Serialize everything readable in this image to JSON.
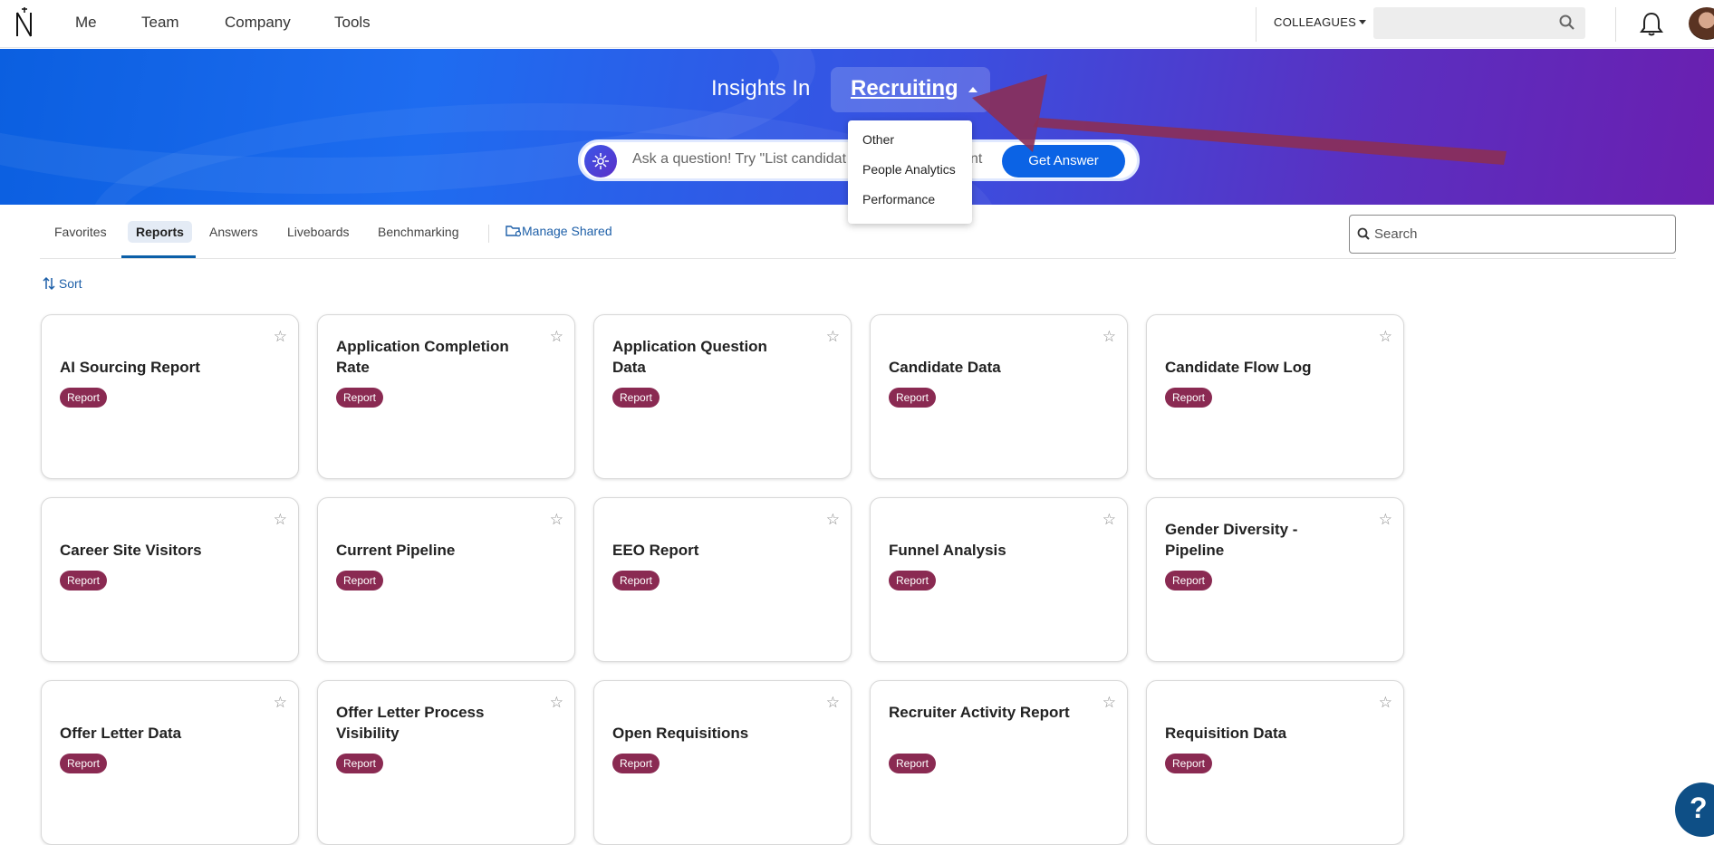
{
  "nav": {
    "links": [
      "Me",
      "Team",
      "Company",
      "Tools"
    ],
    "colleagues_label": "COLLEAGUES",
    "search_placeholder": ""
  },
  "hero": {
    "insights_label": "Insights In",
    "selected_module": "Recruiting",
    "ask_placeholder_a": "Ask a question! Try \"List candidat",
    "ask_placeholder_b": "nt",
    "get_answer_label": "Get Answer"
  },
  "dropdown": {
    "options": [
      "Other",
      "People Analytics",
      "Performance"
    ]
  },
  "tabs": {
    "items": [
      "Favorites",
      "Reports",
      "Answers",
      "Liveboards",
      "Benchmarking"
    ],
    "active": "Reports",
    "manage_label": "Manage Shared",
    "search_placeholder": "Search"
  },
  "sort_label": "Sort",
  "badge_label": "Report",
  "cards": [
    {
      "title": "AI Sourcing Report"
    },
    {
      "title": "Application Completion Rate"
    },
    {
      "title": "Application Question Data"
    },
    {
      "title": "Candidate Data"
    },
    {
      "title": "Candidate Flow Log"
    },
    {
      "title": "Career Site Visitors"
    },
    {
      "title": "Current Pipeline"
    },
    {
      "title": "EEO Report"
    },
    {
      "title": "Funnel Analysis"
    },
    {
      "title": "Gender Diversity - Pipeline"
    },
    {
      "title": "Offer Letter Data"
    },
    {
      "title": "Offer Letter Process Visibility"
    },
    {
      "title": "Open Requisitions"
    },
    {
      "title": "Recruiter Activity Report"
    },
    {
      "title": "Requisition Data"
    }
  ],
  "help_label": "?",
  "colors": {
    "brand_blue": "#0b63e5",
    "badge": "#8a2a52",
    "annotation_arrow": "#8b2f56"
  }
}
